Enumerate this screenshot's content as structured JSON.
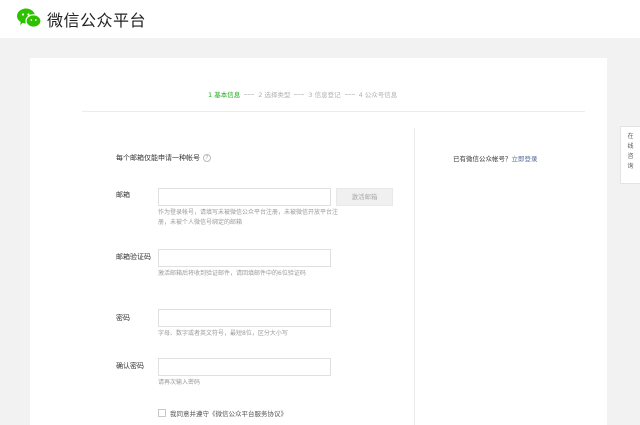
{
  "header": {
    "title": "微信公众平台",
    "logo_icon": "wechat-logo-icon"
  },
  "steps": [
    {
      "label": "1 基本信息",
      "active": true
    },
    {
      "label": "2 选择类型",
      "active": false
    },
    {
      "label": "3 信息登记",
      "active": false
    },
    {
      "label": "4 公众号信息",
      "active": false
    }
  ],
  "form": {
    "notice": "每个邮箱仅能申请一种帐号",
    "email": {
      "label": "邮箱",
      "value": "",
      "placeholder": "",
      "button": "激活邮箱",
      "hint": "作为登录帐号，请填写未被微信公众平台注册，未被微信开放平台注册，未被个人微信号绑定的邮箱"
    },
    "verify_code": {
      "label": "邮箱验证码",
      "value": "",
      "placeholder": "",
      "hint": "激活邮箱后将收到验证邮件，请回填邮件中的6位验证码"
    },
    "password": {
      "label": "密码",
      "value": "",
      "placeholder": "",
      "hint": "字母、数字或者英文符号，最短8位，区分大小写"
    },
    "confirm_password": {
      "label": "确认密码",
      "value": "",
      "placeholder": "",
      "hint": "请再次输入密码"
    },
    "agreement": "我同意并遵守《微信公众平台服务协议》"
  },
  "login": {
    "prompt": "已有微信公众帐号？",
    "link": "立即登录"
  },
  "side_widget": {
    "label": "在线咨询"
  },
  "colors": {
    "accent": "#1aad19",
    "link": "#576b95",
    "background": "#f2f2f2"
  }
}
